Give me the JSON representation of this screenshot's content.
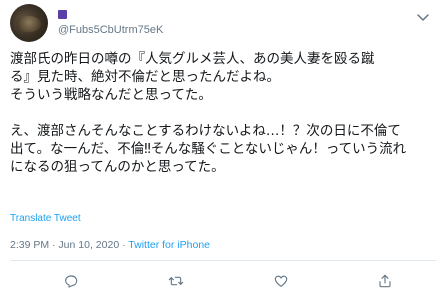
{
  "tweet": {
    "author": {
      "handle": "@Fubs5CbUtrm75eK"
    },
    "text": "渡部氏の昨日の噂の『人気グルメ芸人、あの美人妻を殴る蹴\nる』見た時、絶対不倫だと思ったんだよね。\nそういう戦略なんだと思ってた。\n\nえ、渡部さんそんなことするわけないよね…！？次の日に不倫て\n出て。な一んだ、不倫‼そんな騒ぐことないじゃん！っていう流れ\nになるの狙ってんのかと思ってた。",
    "translate_label": "Translate Tweet",
    "timestamp": "2:39 PM · Jun 10, 2020 · ",
    "source": "Twitter for iPhone"
  },
  "actions": [
    {
      "name": "reply",
      "icon": "reply-icon"
    },
    {
      "name": "retweet",
      "icon": "retweet-icon"
    },
    {
      "name": "like",
      "icon": "heart-icon"
    },
    {
      "name": "share",
      "icon": "share-icon"
    }
  ],
  "colors": {
    "accent": "#1da1f2",
    "muted": "#657786",
    "text": "#14171a",
    "divider": "#e1e8ed"
  }
}
